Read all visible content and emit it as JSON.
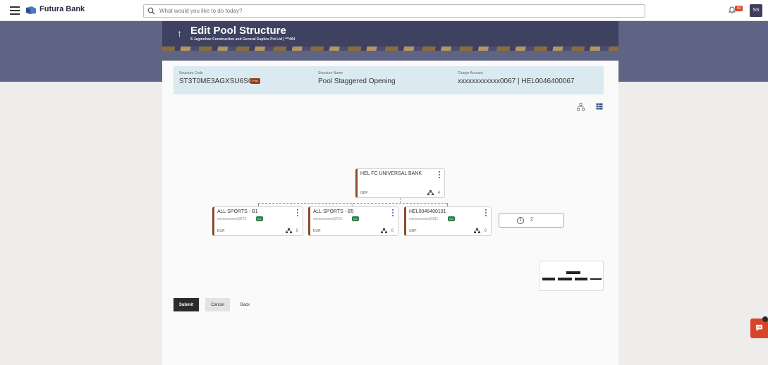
{
  "app": {
    "brand": "Futura Bank",
    "search_placeholder": "What would you like to do today?",
    "user_initials": "SS",
    "notification_badge": "99"
  },
  "header": {
    "title": "Edit Pool Structure",
    "subtitle": "S Jagmohan Construction and General Suplies Pvt Ltd | ***464"
  },
  "structure": {
    "code_label": "Structure Code",
    "code_value": "ST3T0ME3AGXSU6SC4",
    "pool_badge": "Pool",
    "name_label": "Structure Name",
    "name_value": "Pool Staggered Opening",
    "charge_label": "Charge Account",
    "charge_value": "xxxxxxxxxxxx0067 | HEL0046400067"
  },
  "tree": {
    "root": {
      "name": "HEL FC UNIVERSAL BANK",
      "currency": "GBP",
      "children": "4"
    },
    "nodes": [
      {
        "name": "ALL SPORTS - B1",
        "account": "xxxxxxxxxxxx0679",
        "badge": "Ino",
        "currency": "EUR",
        "children": "0"
      },
      {
        "name": "ALL SPORTS - B5",
        "account": "xxxxxxxxxxxx0715",
        "badge": "Ino",
        "currency": "EUR",
        "children": "0"
      },
      {
        "name": "HEL0046400191",
        "account": "xxxxxxxxxxxx0191",
        "badge": "Ino",
        "currency": "GBP",
        "children": "0"
      }
    ],
    "more_nodes": "2"
  },
  "actions": {
    "submit": "Submit",
    "cancel": "Cancel",
    "back": "Back"
  },
  "colors": {
    "accent_brown": "#8b4a2b",
    "header_band": "#5f6384",
    "info_panel": "#dbeaf1",
    "chat_button": "#d64529"
  }
}
